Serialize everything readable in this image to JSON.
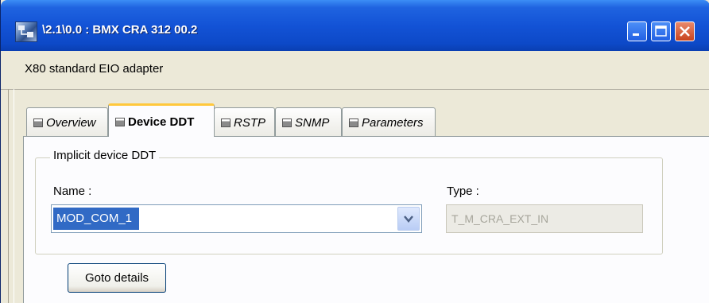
{
  "window": {
    "title": "\\2.1\\0.0 : BMX CRA 312 00.2",
    "subtitle": "X80 standard EIO adapter",
    "controls": {
      "minimize": "minimize-icon",
      "maximize": "maximize-icon",
      "close": "close-icon"
    }
  },
  "tabs": [
    {
      "label": "Overview",
      "active": false
    },
    {
      "label": "Device DDT",
      "active": true
    },
    {
      "label": "RSTP",
      "active": false
    },
    {
      "label": "SNMP",
      "active": false
    },
    {
      "label": "Parameters",
      "active": false
    }
  ],
  "device_ddt": {
    "group_title": "Implicit device DDT",
    "name_label": "Name :",
    "name_value": "MOD_COM_1",
    "type_label": "Type :",
    "type_value": "T_M_CRA_EXT_IN",
    "goto_button": "Goto details"
  },
  "colors": {
    "titlebar": "#0d49c8",
    "selection": "#316ac5",
    "active_tab_accent": "#ffc83c",
    "window_bg": "#ece9d8"
  }
}
